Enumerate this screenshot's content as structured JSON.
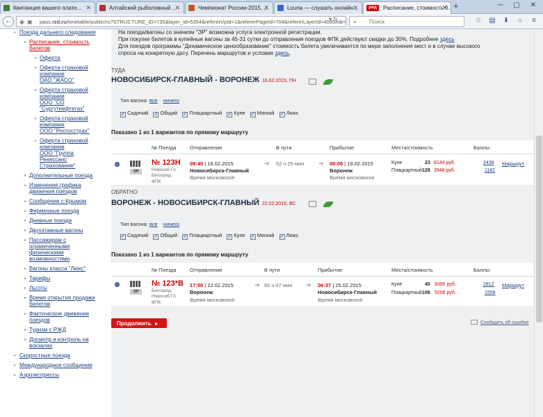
{
  "browser": {
    "tabs": [
      {
        "title": "Квитанция вашего плате...",
        "active": false,
        "favicon_color": "#4a7b3a"
      },
      {
        "title": "Алтайский рыболовный ...",
        "active": false,
        "favicon_color": "#b03030"
      },
      {
        "title": "Чемпионат России-2015, ...",
        "active": false,
        "favicon_color": "#c05a20"
      },
      {
        "title": "Louna — слушать онлайн...",
        "active": false,
        "favicon_color": "#3366cc"
      },
      {
        "title": "Расписание, стоимость б...",
        "active": true,
        "favicon_color": "#d00000",
        "badge": "ржд"
      }
    ],
    "url_prefix": "pass.",
    "url_domain": "rzd.ru",
    "url_rest": "/timetable/public/ru?STRUCTURE_ID=735&layer_id=5354&refererVpId=1&refererPageId=704&refererLayerId=4065#dir=1|tf",
    "search_placeholder": "Поиск",
    "tool_icons": [
      "star-icon",
      "clipboard-icon",
      "download-icon",
      "home-icon",
      "menu-icon"
    ]
  },
  "sidebar": {
    "items": [
      {
        "label": "Поезда дальнего следования",
        "level": 0,
        "active": false
      },
      {
        "label": "Расписание, стоимость",
        "level": 1,
        "active": true
      },
      {
        "label": "билетов",
        "level": 1,
        "active": true,
        "continuation": true
      },
      {
        "label": "Оферта",
        "level": 2
      },
      {
        "label": "Оферта страховой",
        "level": 2
      },
      {
        "label": "компании",
        "level": 2,
        "continuation": true
      },
      {
        "label": "ОАО \"ЖАСО\"",
        "level": 2,
        "continuation": true
      },
      {
        "label": "Оферта страховой",
        "level": 2
      },
      {
        "label": "компании",
        "level": 2,
        "continuation": true
      },
      {
        "label": "ООО \"СО",
        "level": 2,
        "continuation": true
      },
      {
        "label": "\"Сургутнефтегаз\"",
        "level": 2,
        "continuation": true
      },
      {
        "label": "Оферта страховой",
        "level": 2
      },
      {
        "label": "компании",
        "level": 2,
        "continuation": true
      },
      {
        "label": "ООО \"Росгосстрах\"",
        "level": 2,
        "continuation": true
      },
      {
        "label": "Оферта страховой",
        "level": 2
      },
      {
        "label": "компании",
        "level": 2,
        "continuation": true
      },
      {
        "label": "ООО \"Группа",
        "level": 2,
        "continuation": true
      },
      {
        "label": "Ренессанс",
        "level": 2,
        "continuation": true
      },
      {
        "label": "Страхование\"",
        "level": 2,
        "continuation": true
      },
      {
        "label": "Дополнительные поезда",
        "level": 1
      },
      {
        "label": "Изменения графика",
        "level": 1
      },
      {
        "label": "движения поездов",
        "level": 1,
        "continuation": true
      },
      {
        "label": "Сообщение с Крымом",
        "level": 1
      },
      {
        "label": "Фирменные поезда",
        "level": 1
      },
      {
        "label": "Дневные поезда",
        "level": 1
      },
      {
        "label": "Двухэтажные вагоны",
        "level": 1
      },
      {
        "label": "Пассажирам с",
        "level": 1
      },
      {
        "label": "ограниченными",
        "level": 1,
        "continuation": true
      },
      {
        "label": "физическими",
        "level": 1,
        "continuation": true
      },
      {
        "label": "возможностями",
        "level": 1,
        "continuation": true
      },
      {
        "label": "Вагоны класса \"Люкс\"",
        "level": 1
      },
      {
        "label": "Тарифы",
        "level": 1
      },
      {
        "label": "Льготы",
        "level": 1
      },
      {
        "label": "Время открытия продажи",
        "level": 1
      },
      {
        "label": "билетов",
        "level": 1,
        "continuation": true
      },
      {
        "label": "Фактическое движение",
        "level": 1
      },
      {
        "label": "поездов",
        "level": 1,
        "continuation": true
      },
      {
        "label": "Туризм с РЖД",
        "level": 1
      },
      {
        "label": "Досмотр и контроль на",
        "level": 1
      },
      {
        "label": "вокзалах",
        "level": 1,
        "continuation": true
      },
      {
        "label": "Скоростные поезда",
        "level": 0
      },
      {
        "label": "Международное сообщение",
        "level": 0
      },
      {
        "label": "Аэроэкспрессы",
        "level": 0
      }
    ]
  },
  "notice": {
    "line1_pre": "На поезда/вагоны со значком \"ЭР\" возможна услуга электронной регистрации.",
    "line2_pre": "При покупке билетов в купейные вагоны за 45-31 сутки до отправления поездов ФПК действуют скидки до 30%. Подробнее ",
    "line2_link": "здесь",
    "line3": "Для поездов программы \"Динамическое ценообразование\" стоимость билета увеличивается по мере заполнения мест и в случае высокого",
    "line4_pre": "спроса на конкретную дату. Перечень маршрутов и условия ",
    "line4_link": "здесь",
    "line4_post": "."
  },
  "filters": {
    "label": "Тип вагона:",
    "all": "все",
    "none": "ничего",
    "car_types": [
      "Сидячий",
      "Общий",
      "Плацкартный",
      "Купе",
      "Мягкий",
      "Люкс"
    ]
  },
  "columns": {
    "train": "№ Поезда",
    "departure": "Отправление",
    "travel": "В пути",
    "arrival": "Прибытие",
    "seats": "Места/стоимость",
    "points": "Баллы"
  },
  "outbound": {
    "direction": "ТУДА",
    "title": "НОВОСИБИРСК-ГЛАВНЫЙ - ВОРОНЕЖ",
    "date": "16.02.2015, ПН",
    "shown": "Показано 1 из 1 вариантов по прямому маршруту",
    "train": {
      "number": "№ 123Н",
      "route_from": "Новосиб Гл",
      "route_to": "Белгород",
      "carrier": "ФПК",
      "er": "ЭР",
      "dep_time": "09:40",
      "dep_date": "16.02.2015",
      "dep_station": "Новосибирск-Главный",
      "time_note": "Время московское",
      "duration": "62 ч 25 мин",
      "arr_time": "00:05",
      "arr_date": "19.02.2015",
      "arr_station": "Воронеж",
      "arr_note": "Время московское",
      "classes": [
        {
          "name": "Купе",
          "seats": "23",
          "price": "8144 руб.",
          "points": "2438"
        },
        {
          "name": "Плацкартный",
          "seats": "128",
          "price": "3948 руб.",
          "points": "1182"
        }
      ],
      "route_link": "Маршрут"
    }
  },
  "return": {
    "direction": "ОБРАТНО",
    "title": "ВОРОНЕЖ - НОВОСИБИРСК-ГЛАВНЫЙ",
    "date": "22.02.2015, ВС",
    "shown": "Показано 1 из 1 вариантов по прямому маршруту",
    "train": {
      "number": "№ 123*В",
      "route_from": "Белгород",
      "route_to": "Новосиб Гл",
      "carrier": "ФПК",
      "er": "ЭР",
      "dep_time": "17:50",
      "dep_date": "22.02.2015",
      "dep_station": "Воронеж",
      "time_note": "Время московское",
      "duration": "60 ч 47 мин",
      "arr_time": "06:37",
      "arr_date": "25.02.2015",
      "arr_station": "Новосибирск-Главный",
      "arr_note": "Время московское",
      "classes": [
        {
          "name": "Купе",
          "seats": "45",
          "price": "9395 руб.",
          "points": "2812"
        },
        {
          "name": "Плацкартный",
          "seats": "108",
          "price": "5206 руб.",
          "points": "1558"
        }
      ],
      "route_link": "Маршрут"
    }
  },
  "actions": {
    "continue": "Продолжить",
    "report": "Сообщить об ошибке"
  }
}
